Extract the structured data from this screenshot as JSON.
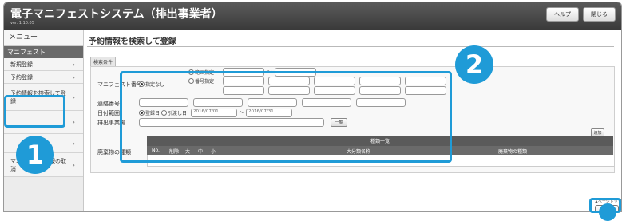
{
  "app": {
    "title": "電子マニフェストシステム（排出事業者）",
    "version": "ver. 1.10.05",
    "help_label": "ヘルプ",
    "close_label": "閉じる",
    "session_info": ""
  },
  "sidebar": {
    "title": "メニュー",
    "section": "マニフェスト",
    "items": [
      {
        "label": "新規登録"
      },
      {
        "label": "予約登録"
      },
      {
        "label": "予約情報を検索して登録"
      },
      {
        "label": ""
      },
      {
        "label": ""
      },
      {
        "label": "マニフェスト情報の取消"
      }
    ]
  },
  "main": {
    "page_title": "予約情報を検索して登録",
    "search_tab": "検索条件",
    "form": {
      "manifest_no_label": "マニフェスト番号",
      "opt_none": "指定なし",
      "opt_range": "範囲指定",
      "opt_number": "番号指定",
      "range_sep": "〜",
      "contact_label": "連絡番号",
      "date_label": "日付範囲",
      "date_opt_register": "登録日",
      "date_opt_delivery": "引渡し日",
      "date_from": "2016/07/01",
      "date_sep": "〜",
      "date_to": "2016/07/31",
      "site_label": "排出事業場",
      "list_btn": "一覧",
      "waste_label": "廃棄物の種類",
      "add_btn": "追加",
      "grid_title": "種類一覧",
      "columns": [
        "No.",
        "削除",
        "大",
        "中",
        "小",
        "大分類名称",
        "廃棄物の種類"
      ]
    },
    "search_button": "検索",
    "page_top": "▲ページトップ"
  },
  "annotations": {
    "badge_1": "1",
    "badge_2": "2",
    "accent": "#1f9bd7"
  }
}
